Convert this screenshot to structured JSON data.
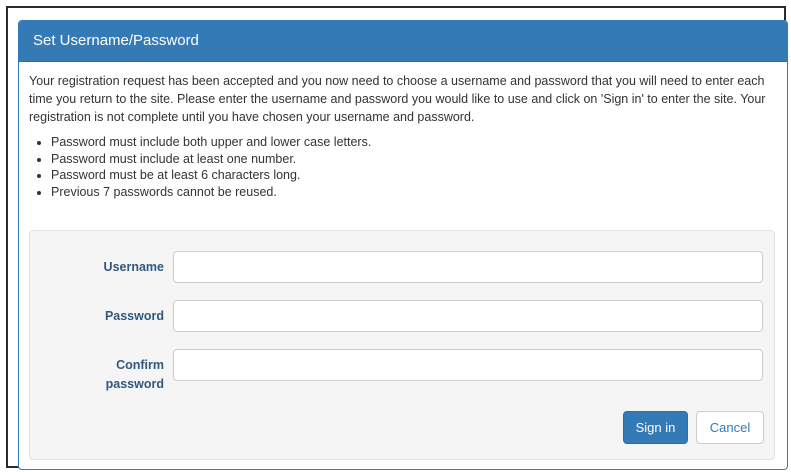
{
  "panel": {
    "title": "Set Username/Password",
    "intro": "Your registration request has been accepted and you now need to choose a username and password that you will need to enter each time you return to the site. Please enter the username and password you would like to use and click on 'Sign in' to enter the site. Your registration is not complete until you have chosen your username and password.",
    "rules": [
      "Password must include both upper and lower case letters.",
      "Password must include at least one number.",
      "Password must be at least 6 characters long.",
      "Previous 7 passwords cannot be reused."
    ]
  },
  "form": {
    "username_label": "Username",
    "username_value": "",
    "password_label": "Password",
    "password_value": "",
    "confirm_label_line1": "Confirm",
    "confirm_label_line2": "password",
    "confirm_value": "",
    "sign_in_label": "Sign in",
    "cancel_label": "Cancel"
  },
  "colors": {
    "primary": "#337ab7",
    "label": "#31587e",
    "well_bg": "#f5f5f5"
  }
}
